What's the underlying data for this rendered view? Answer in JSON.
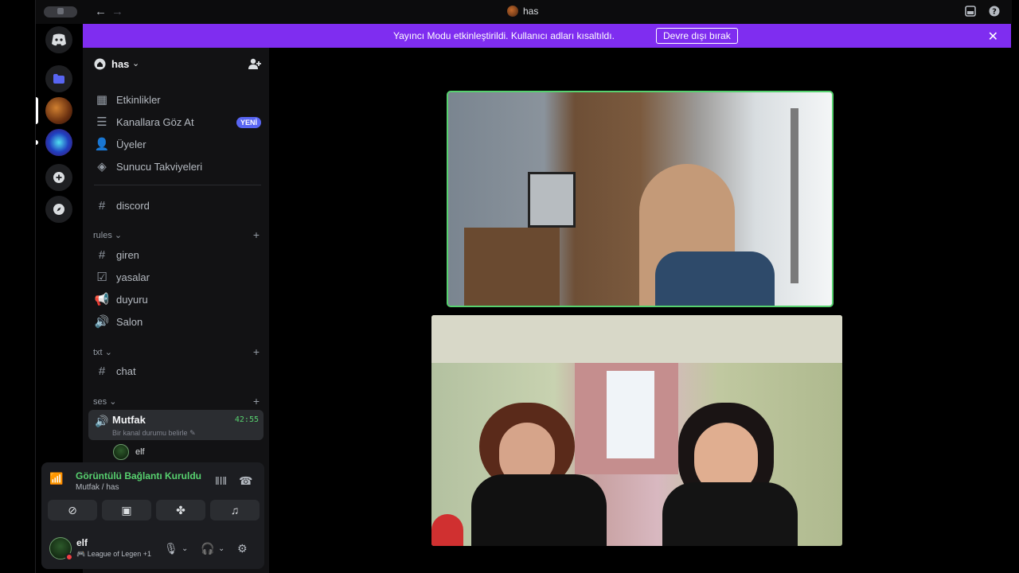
{
  "titlebar": {
    "title": "has",
    "back_icon": "arrow-left-icon",
    "forward_icon": "arrow-right-icon",
    "inbox_icon": "inbox-icon",
    "help_icon": "help-icon"
  },
  "banner": {
    "text": "Yayıncı Modu etkinleştirildi. Kullanıcı adları kısaltıldı.",
    "button": "Devre dışı bırak",
    "color": "#7f2df0"
  },
  "server": {
    "name": "has",
    "nav": [
      {
        "label": "Etkinlikler",
        "icon": "calendar-icon"
      },
      {
        "label": "Kanallara Göz At",
        "icon": "browse-channels-icon",
        "badge": "YENİ"
      },
      {
        "label": "Üyeler",
        "icon": "members-icon"
      },
      {
        "label": "Sunucu Takviyeleri",
        "icon": "boost-icon"
      }
    ],
    "uncategorized": [
      {
        "name": "discord",
        "icon": "hash-icon"
      }
    ],
    "categories": [
      {
        "name": "rules",
        "channels": [
          {
            "name": "giren",
            "icon": "hash-icon"
          },
          {
            "name": "yasalar",
            "icon": "rules-icon"
          },
          {
            "name": "duyuru",
            "icon": "announcement-icon"
          },
          {
            "name": "Salon",
            "icon": "speaker-icon"
          }
        ]
      },
      {
        "name": "txt",
        "channels": [
          {
            "name": "chat",
            "icon": "hash-icon"
          }
        ]
      },
      {
        "name": "ses",
        "channels": []
      }
    ],
    "active_voice": {
      "name": "Mutfak",
      "time": "42:55",
      "status_placeholder": "Bir kanal durumu belirle",
      "member": "elf"
    }
  },
  "voice_panel": {
    "title": "Görüntülü Bağlantı Kuruldu",
    "subtitle": "Mutfak / has",
    "accent": "#57d16f"
  },
  "user": {
    "name": "elf",
    "status": "League of Legen +1"
  }
}
